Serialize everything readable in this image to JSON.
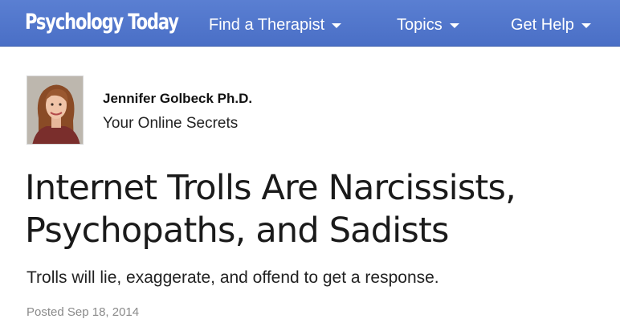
{
  "nav": {
    "logo": "Psychology Today",
    "items": [
      {
        "label": "Find a Therapist"
      },
      {
        "label": "Topics"
      },
      {
        "label": "Get Help"
      }
    ]
  },
  "author": {
    "name": "Jennifer Golbeck Ph.D.",
    "blog": "Your Online Secrets"
  },
  "article": {
    "title": "Internet Trolls Are Narcissists, Psychopaths, and Sadists",
    "subtitle": "Trolls will lie, exaggerate, and offend to get a response.",
    "posted": "Posted Sep 18, 2014"
  },
  "colors": {
    "nav_background": "#4a6fc6",
    "text": "#1a1a1a",
    "muted": "#8a8a8a"
  }
}
